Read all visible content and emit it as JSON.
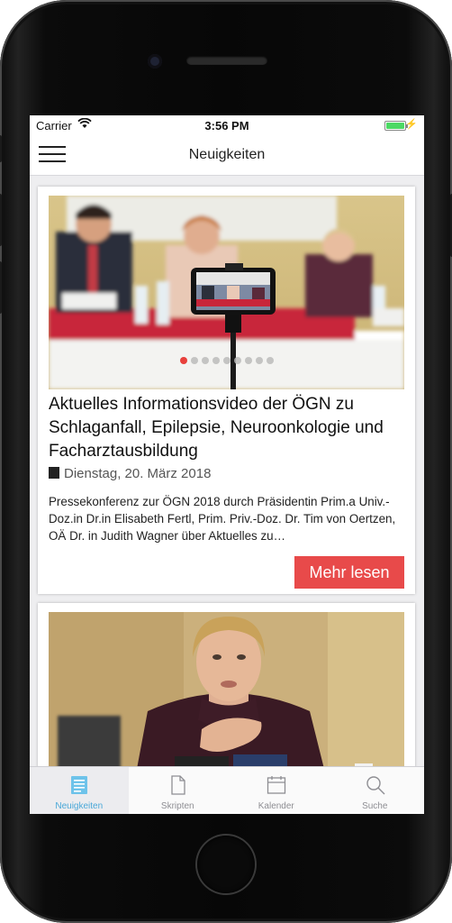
{
  "status_bar": {
    "carrier": "Carrier",
    "time": "3:56 PM",
    "battery_icon": "battery-charging-icon",
    "wifi_icon": "wifi-icon"
  },
  "navbar": {
    "title": "Neuigkeiten",
    "menu_icon": "hamburger-menu-icon"
  },
  "articles": [
    {
      "title": "Aktuelles Informationsvideo der ÖGN zu Schlaganfall, Epilepsie, Neuroonkologie und Facharztausbildung",
      "date": "Dienstag, 20. März 2018",
      "excerpt": "Pressekonferenz zur ÖGN 2018 durch Präsidentin Prim.a Univ.-Doz.in Dr.in Elisabeth Fertl, Prim. Priv.-Doz. Dr. Tim von Oertzen, OÄ Dr. in Judith Wagner über Aktuelles zu…",
      "button_label": "Mehr lesen",
      "image_slides": 9,
      "active_slide": 1
    },
    {
      "title": "",
      "image": "woman-speaking-at-press-conference"
    }
  ],
  "tabs": [
    {
      "label": "Neuigkeiten",
      "icon": "newspaper-icon",
      "active": true
    },
    {
      "label": "Skripten",
      "icon": "document-icon",
      "active": false
    },
    {
      "label": "Kalender",
      "icon": "calendar-icon",
      "active": false
    },
    {
      "label": "Suche",
      "icon": "search-icon",
      "active": false
    }
  ],
  "colors": {
    "accent_red": "#e84a4a",
    "tab_active": "#4aa8d8",
    "tab_inactive": "#8e8e93",
    "battery_green": "#4cd964"
  }
}
